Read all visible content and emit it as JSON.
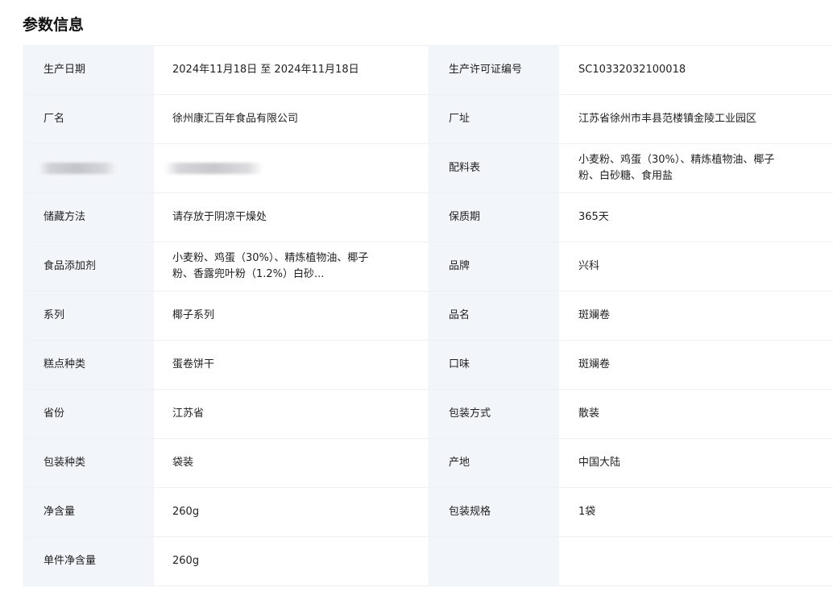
{
  "section": {
    "title": "参数信息"
  },
  "rows": [
    {
      "left_label": "生产日期",
      "left_value": "2024年11月18日 至 2024年11月18日",
      "right_label": "生产许可证编号",
      "right_value": "SC10332032100018"
    },
    {
      "left_label": "厂名",
      "left_value": "徐州康汇百年食品有限公司",
      "right_label": "厂址",
      "right_value": "江苏省徐州市丰县范楼镇金陵工业园区"
    },
    {
      "left_label": "",
      "left_value": "",
      "right_label": "配料表",
      "right_value": "小麦粉、鸡蛋（30%）、精炼植物油、椰子粉、白砂糖、食用盐"
    },
    {
      "left_label": "储藏方法",
      "left_value": "请存放于阴凉干燥处",
      "right_label": "保质期",
      "right_value": "365天"
    },
    {
      "left_label": "食品添加剂",
      "left_value": "小麦粉、鸡蛋（30%）、精炼植物油、椰子粉、香露兜叶粉（1.2%）白砂...",
      "right_label": "品牌",
      "right_value": "兴科"
    },
    {
      "left_label": "系列",
      "left_value": "椰子系列",
      "right_label": "品名",
      "right_value": "斑斓卷"
    },
    {
      "left_label": "糕点种类",
      "left_value": "蛋卷饼干",
      "right_label": "口味",
      "right_value": "斑斓卷"
    },
    {
      "left_label": "省份",
      "left_value": "江苏省",
      "right_label": "包装方式",
      "right_value": "散装"
    },
    {
      "left_label": "包装种类",
      "left_value": "袋装",
      "right_label": "产地",
      "right_value": "中国大陆"
    },
    {
      "left_label": "净含量",
      "left_value": "260g",
      "right_label": "包装规格",
      "right_value": "1袋"
    },
    {
      "left_label": "单件净含量",
      "left_value": "260g",
      "right_label": "",
      "right_value": ""
    }
  ],
  "colors": {
    "label_background": "#f2f5f9",
    "value_background": "#ffffff",
    "border": "#edf0f4",
    "text": "#1f1f1f"
  }
}
